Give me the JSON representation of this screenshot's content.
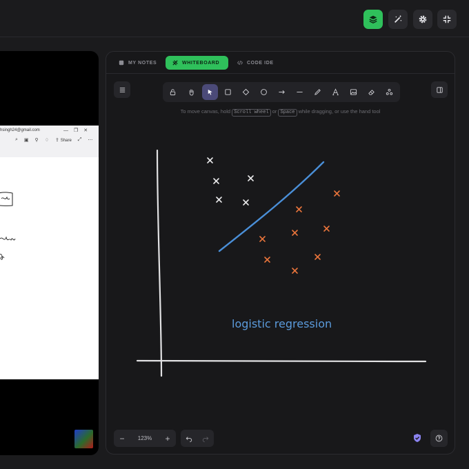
{
  "topbar": {
    "buttons": [
      {
        "icon": "layers-icon",
        "color": "#2fc05b"
      },
      {
        "icon": "magic-wand-icon"
      },
      {
        "icon": "gear-icon"
      },
      {
        "icon": "collapse-icon"
      }
    ]
  },
  "left_panel": {
    "email": "hsingh24@gmail.com",
    "share_label": "Share"
  },
  "tabs": [
    {
      "label": "MY NOTES",
      "icon": "notes-icon",
      "active": false
    },
    {
      "label": "WHITEBOARD",
      "icon": "whiteboard-icon",
      "active": true
    },
    {
      "label": "CODE IDE",
      "icon": "code-icon",
      "active": false
    }
  ],
  "toolbar": {
    "tools": [
      "lock-icon",
      "hand-icon",
      "pointer-icon",
      "rectangle-icon",
      "diamond-icon",
      "circle-icon",
      "arrow-icon",
      "line-icon",
      "pencil-icon",
      "text-icon",
      "image-icon",
      "eraser-icon",
      "extra-tools-icon"
    ],
    "active_tool": "pointer-icon"
  },
  "hint": {
    "prefix": "To move canvas, hold",
    "key1": "Scroll wheel",
    "middle": "or",
    "key2": "Space",
    "suffix": "while dragging, or use the hand tool"
  },
  "whiteboard": {
    "annotation": "logistic regression",
    "annotation_color": "#5b9bdc",
    "class_a_color": "#e8e8ea",
    "class_b_color": "#e8743b",
    "boundary_color": "#4a8fd8"
  },
  "zoom": {
    "minus": "−",
    "value": "123%",
    "plus": "+"
  },
  "accent": "#2fc05b"
}
